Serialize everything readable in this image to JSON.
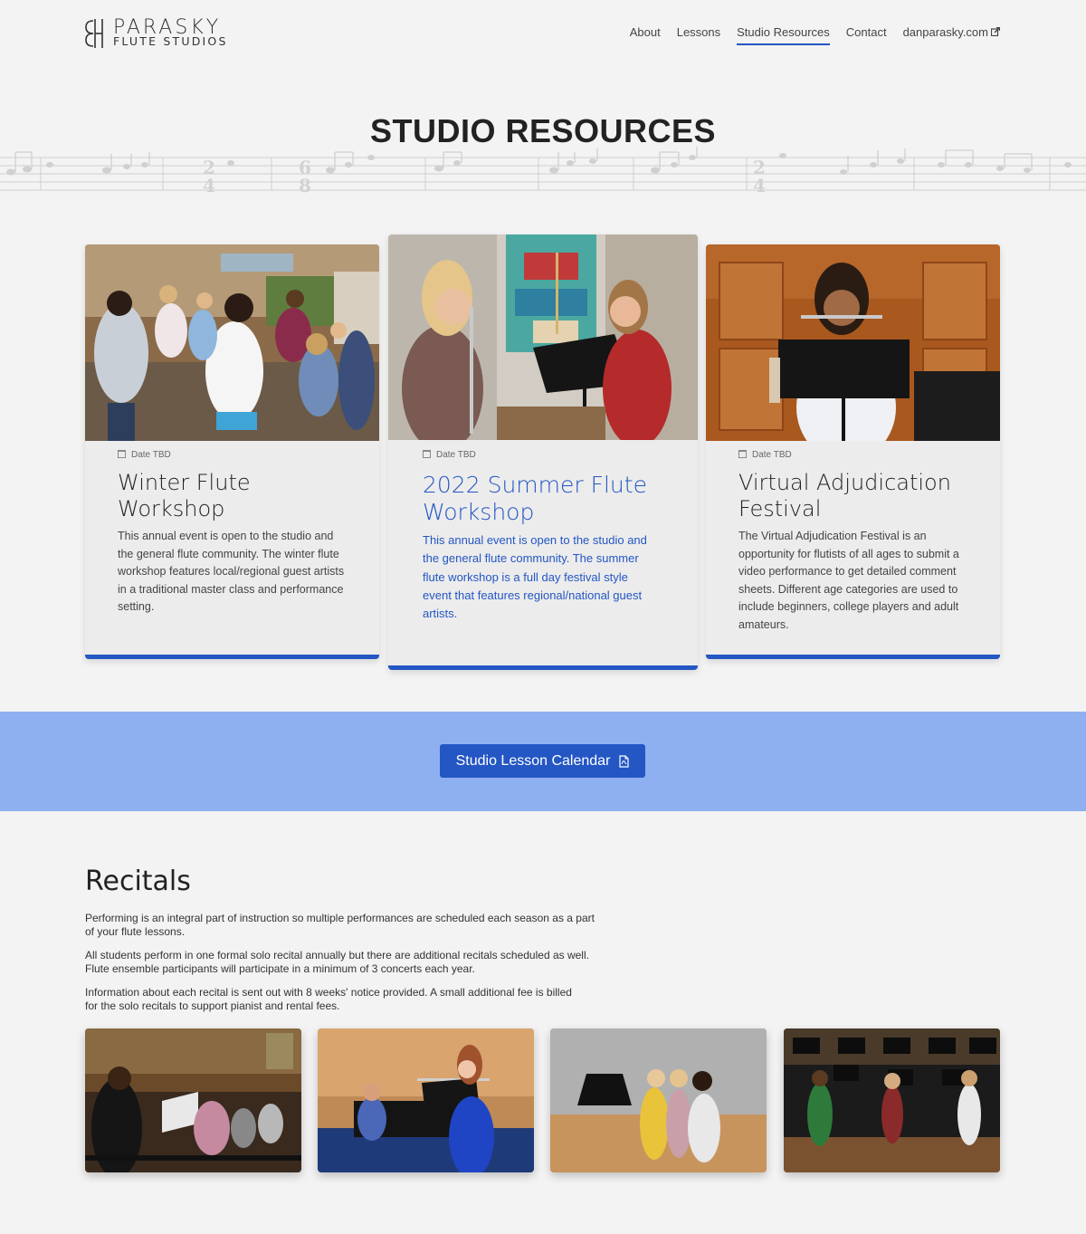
{
  "brand": {
    "line1": "PARASKY",
    "line2": "FLUTE STUDIOS"
  },
  "nav": {
    "items": [
      {
        "label": "About"
      },
      {
        "label": "Lessons"
      },
      {
        "label": "Studio Resources",
        "active": true
      },
      {
        "label": "Contact"
      },
      {
        "label": "danparasky.com",
        "external": true
      }
    ]
  },
  "hero": {
    "title": "STUDIO RESOURCES"
  },
  "cards": [
    {
      "date": "Date TBD",
      "title_line1": "Winter Flute",
      "title_line2": "Workshop",
      "text": "This annual event is open to the studio and the general flute community. The winter flute workshop features local/regional guest artists in a traditional master class and performance setting."
    },
    {
      "date": "Date TBD",
      "title_line1": "2022 Summer Flute",
      "title_line2": "Workshop",
      "text": "This annual event is open to the studio and the general flute community. The summer flute workshop is a full day festival style event that features regional/national guest artists."
    },
    {
      "date": "Date TBD",
      "title_line1": "Virtual Adjudication",
      "title_line2": "Festival",
      "text": "The Virtual Adjudication Festival is an opportunity for flutists of all ages to submit a video performance to get detailed comment sheets. Different age categories are used to include beginners, college players and adult amateurs."
    }
  ],
  "calendar_button": {
    "label": "Studio Lesson Calendar",
    "icon": "pdf-icon"
  },
  "recitals": {
    "title": "Recitals",
    "paragraphs": [
      "Performing is an integral part of instruction so multiple performances are scheduled each season as a part of your flute lessons.",
      "All students perform in one formal solo recital annually but there are additional recitals scheduled as well. Flute ensemble participants will participate in a minimum of 3 concerts each year.",
      "Information about each recital is sent out with 8 weeks' notice provided. A small additional fee is billed for the solo recitals to support pianist and rental fees."
    ]
  },
  "colors": {
    "accent": "#2456c4",
    "band": "#8fb0f0",
    "background": "#f3f3f3"
  }
}
